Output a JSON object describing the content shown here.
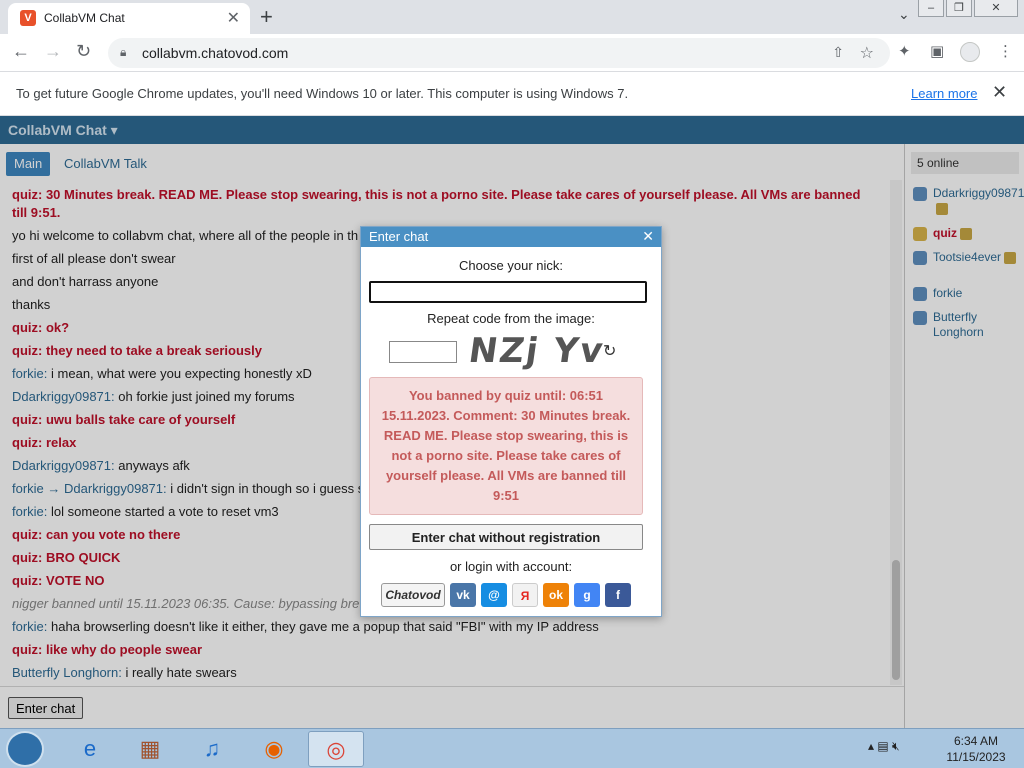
{
  "browser": {
    "tab_title": "CollabVM Chat",
    "url": "collabvm.chatovod.com",
    "infobar_message": "To get future Google Chrome updates, you'll need Windows 10 or later. This computer is using Windows 7.",
    "infobar_link": "Learn more"
  },
  "app": {
    "brand": "CollabVM Chat ▾",
    "tabs": {
      "main": "Main",
      "talk": "CollabVM Talk"
    },
    "online_count": "5 online",
    "enter_chat_button": "Enter chat"
  },
  "messages": [
    {
      "nick": "quiz",
      "sep": ": ",
      "text": "30 Minutes break. READ ME. Please stop swearing, this is not a porno site. Please take cares of yourself please. All VMs are banned till 9:51.",
      "mod": true
    },
    {
      "nick": "",
      "sep": "",
      "text": "yo hi welcome to collabvm chat, where all of the people in th",
      "mod": false
    },
    {
      "nick": "",
      "sep": "",
      "text": "first of all please don't swear",
      "mod": false
    },
    {
      "nick": "",
      "sep": "",
      "text": "and don't harrass anyone",
      "mod": false
    },
    {
      "nick": "",
      "sep": "",
      "text": "thanks",
      "mod": false
    },
    {
      "nick": "quiz",
      "sep": ": ",
      "text": "ok?",
      "mod": true
    },
    {
      "nick": "quiz",
      "sep": ": ",
      "text": "they need to take a break seriously",
      "mod": true
    },
    {
      "nick": "forkie",
      "sep": ": ",
      "text": "i mean, what were you expecting honestly xD",
      "mod": false
    },
    {
      "nick": "Ddarkriggy09871",
      "sep": ": ",
      "text": "oh forkie just joined my forums",
      "mod": false
    },
    {
      "nick": "quiz",
      "sep": ": ",
      "text": "uwu balls take care of yourself",
      "mod": true
    },
    {
      "nick": "quiz",
      "sep": ": ",
      "text": "relax",
      "mod": true
    },
    {
      "nick": "Ddarkriggy09871",
      "sep": ": ",
      "text": "anyways afk",
      "mod": false
    },
    {
      "nick": "forkie → Ddarkriggy09871",
      "sep": ": ",
      "text": "i didn't sign in though so i guess s",
      "mod": false
    },
    {
      "nick": "forkie",
      "sep": ": ",
      "text": "lol someone started a vote to reset vm3",
      "mod": false
    },
    {
      "nick": "quiz",
      "sep": ": ",
      "text": "can you vote no there",
      "mod": true
    },
    {
      "nick": "quiz",
      "sep": ": ",
      "text": "BRO QUICK",
      "mod": true
    },
    {
      "nick": "quiz",
      "sep": ": ",
      "text": "VOTE NO",
      "mod": true
    },
    {
      "nick": "",
      "sep": "",
      "text": "nigger banned until 15.11.2023 06:35. Cause: bypassing bre",
      "mod": false,
      "sys": true
    },
    {
      "nick": "forkie",
      "sep": ": ",
      "text": "haha browserling doesn't like it either, they gave me a popup that said \"FBI\" with my IP address",
      "mod": false
    },
    {
      "nick": "quiz",
      "sep": ": ",
      "text": "like why do people swear",
      "mod": true
    },
    {
      "nick": "Butterfly Longhorn",
      "sep": ": ",
      "text": "i really hate swears",
      "mod": false
    }
  ],
  "users": [
    {
      "name": "Ddarkriggy09871",
      "mod": false,
      "badge": true
    },
    {
      "name": "quiz",
      "mod": true,
      "badge": true
    },
    {
      "name": "Tootsie4ever",
      "mod": false,
      "badge": true
    },
    {
      "name": "forkie",
      "mod": false,
      "badge": false
    },
    {
      "name": "Butterfly Longhorn",
      "mod": false,
      "badge": false
    }
  ],
  "modal": {
    "title": "Enter chat",
    "nick_label": "Choose your nick:",
    "nick_value": "",
    "code_label": "Repeat code from the image:",
    "captcha_text": "NZj Yv",
    "ban_message": "You banned by quiz until: 06:51 15.11.2023. Comment: 30 Minutes break. READ ME. Please stop swearing, this is not a porno site. Please take cares of yourself please. All VMs are banned till 9:51",
    "no_reg_button": "Enter chat without registration",
    "or_login": "or login with account:",
    "chatovod_label": "Chatovod"
  },
  "taskbar": {
    "time": "6:34 AM",
    "date": "11/15/2023"
  },
  "colors": {
    "appbar": "#2e6b94",
    "mod_red": "#c0102a",
    "nick_blue": "#2e6b94",
    "ban_bg": "#f5dede",
    "modal_head": "#4a90c4"
  }
}
